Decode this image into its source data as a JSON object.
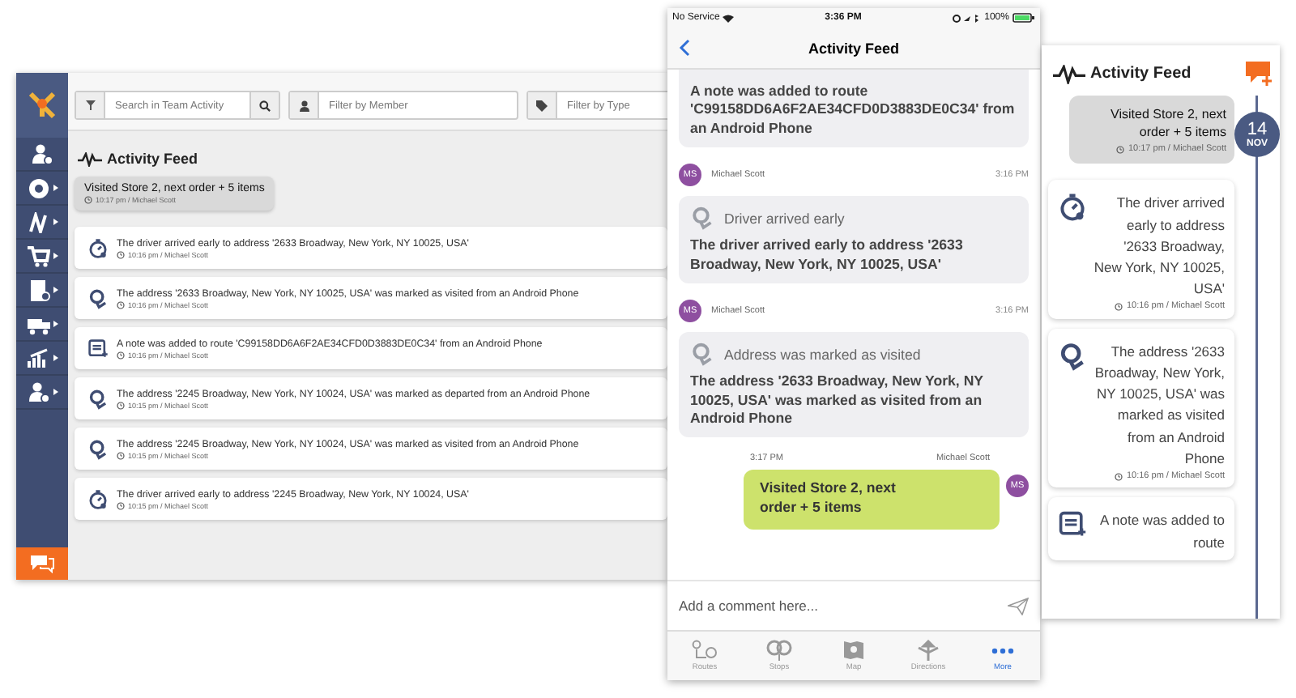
{
  "desktop": {
    "search_placeholder": "Search in Team Activity",
    "member_placeholder": "Filter by Member",
    "type_placeholder": "Filter by Type",
    "title": "Activity Feed",
    "note": {
      "text": "Visited Store 2, next order + 5 items",
      "meta": "10:17 pm / Michael Scott"
    },
    "activities": [
      {
        "kind": "early",
        "text": "The driver arrived early to address '2633 Broadway, New York, NY 10025, USA'",
        "meta": "10:16 pm / Michael Scott"
      },
      {
        "kind": "visited",
        "text": "The address '2633 Broadway, New York, NY 10025, USA' was marked as visited from an Android Phone",
        "meta": "10:16 pm / Michael Scott"
      },
      {
        "kind": "note",
        "text": "A note was added to route 'C99158DD6A6F2AE34CFD0D3883DE0C34' from an Android Phone",
        "meta": "10:16 pm / Michael Scott"
      },
      {
        "kind": "visited",
        "text": "The address '2245 Broadway, New York, NY 10024, USA' was marked as departed from an Android Phone",
        "meta": "10:15 pm / Michael Scott"
      },
      {
        "kind": "visited",
        "text": "The address '2245 Broadway, New York, NY 10024, USA' was marked as visited from an Android Phone",
        "meta": "10:15 pm / Michael Scott"
      },
      {
        "kind": "early",
        "text": "The driver arrived early to address '2245 Broadway, New York, NY 10024, USA'",
        "meta": "10:15 pm / Michael Scott"
      }
    ]
  },
  "mobile": {
    "status": {
      "carrier": "No Service",
      "time": "3:36 PM",
      "battery": "100%"
    },
    "title": "Activity Feed",
    "messages": [
      {
        "kind": "event",
        "text": "A note was added to route 'C99158DD6A6F2AE34CFD0D3883DE0C34' from an Android Phone"
      },
      {
        "kind": "event",
        "initials": "MS",
        "author": "Michael Scott",
        "time": "3:16 PM",
        "title": "Driver arrived early",
        "text": "The driver arrived early to address '2633 Broadway, New York, NY 10025, USA'"
      },
      {
        "kind": "event",
        "initials": "MS",
        "author": "Michael Scott",
        "time": "3:16 PM",
        "title": "Address was marked as visited",
        "text": "The address '2633 Broadway, New York, NY 10025, USA' was marked as visited from an Android Phone"
      },
      {
        "kind": "own",
        "initials": "MS",
        "author": "Michael Scott",
        "time": "3:17 PM",
        "text": "Visited Store 2, next order + 5 items"
      }
    ],
    "comment_placeholder": "Add a comment here...",
    "tabs": [
      {
        "label": "Routes",
        "selected": false
      },
      {
        "label": "Stops",
        "selected": false
      },
      {
        "label": "Map",
        "selected": false
      },
      {
        "label": "Directions",
        "selected": false
      },
      {
        "label": "More",
        "selected": true
      }
    ]
  },
  "panel": {
    "title": "Activity Feed",
    "date": {
      "day": "14",
      "month": "NOV"
    },
    "note": {
      "text": "Visited Store 2, next order + 5 items",
      "meta": "10:17 pm / Michael Scott"
    },
    "activities": [
      {
        "kind": "early",
        "text": "The driver arrived early to address '2633 Broadway, New York, NY 10025, USA'",
        "meta": "10:16 pm / Michael Scott"
      },
      {
        "kind": "visited",
        "text": "The address '2633 Broadway, New York, NY 10025, USA' was marked as visited from an Android Phone",
        "meta": "10:16 pm / Michael Scott"
      },
      {
        "kind": "note",
        "text": "A note was added to route"
      }
    ]
  }
}
